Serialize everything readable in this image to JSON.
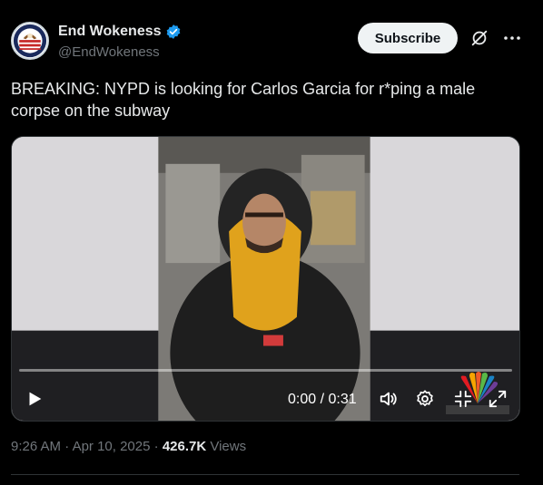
{
  "author": {
    "display_name": "End Wokeness",
    "handle": "@EndWokeness",
    "verified": true,
    "avatar_icon": "eagle-flag-badge"
  },
  "actions": {
    "subscribe_label": "Subscribe",
    "grok_icon": "grok-icon",
    "more_icon": "more-icon"
  },
  "tweet": {
    "text": "BREAKING: NYPD is looking for Carlos Garcia for r*ping a male corpse on the subway"
  },
  "video": {
    "time_display": "0:00 / 0:31",
    "progress": 0.0,
    "watermark": "NBC peacock logo",
    "controls": [
      "play-icon",
      "volume-icon",
      "settings-icon",
      "fullscreen-exit-icon",
      "expand-icon"
    ]
  },
  "meta": {
    "time": "9:26 AM",
    "separator": "·",
    "date": "Apr 10, 2025",
    "views_count": "426.7K",
    "views_label": "Views"
  },
  "colors": {
    "background": "#000000",
    "text": "#e7e9ea",
    "muted": "#71767b",
    "verified": "#1d9bf0",
    "subscribe_bg": "#eff3f4"
  }
}
